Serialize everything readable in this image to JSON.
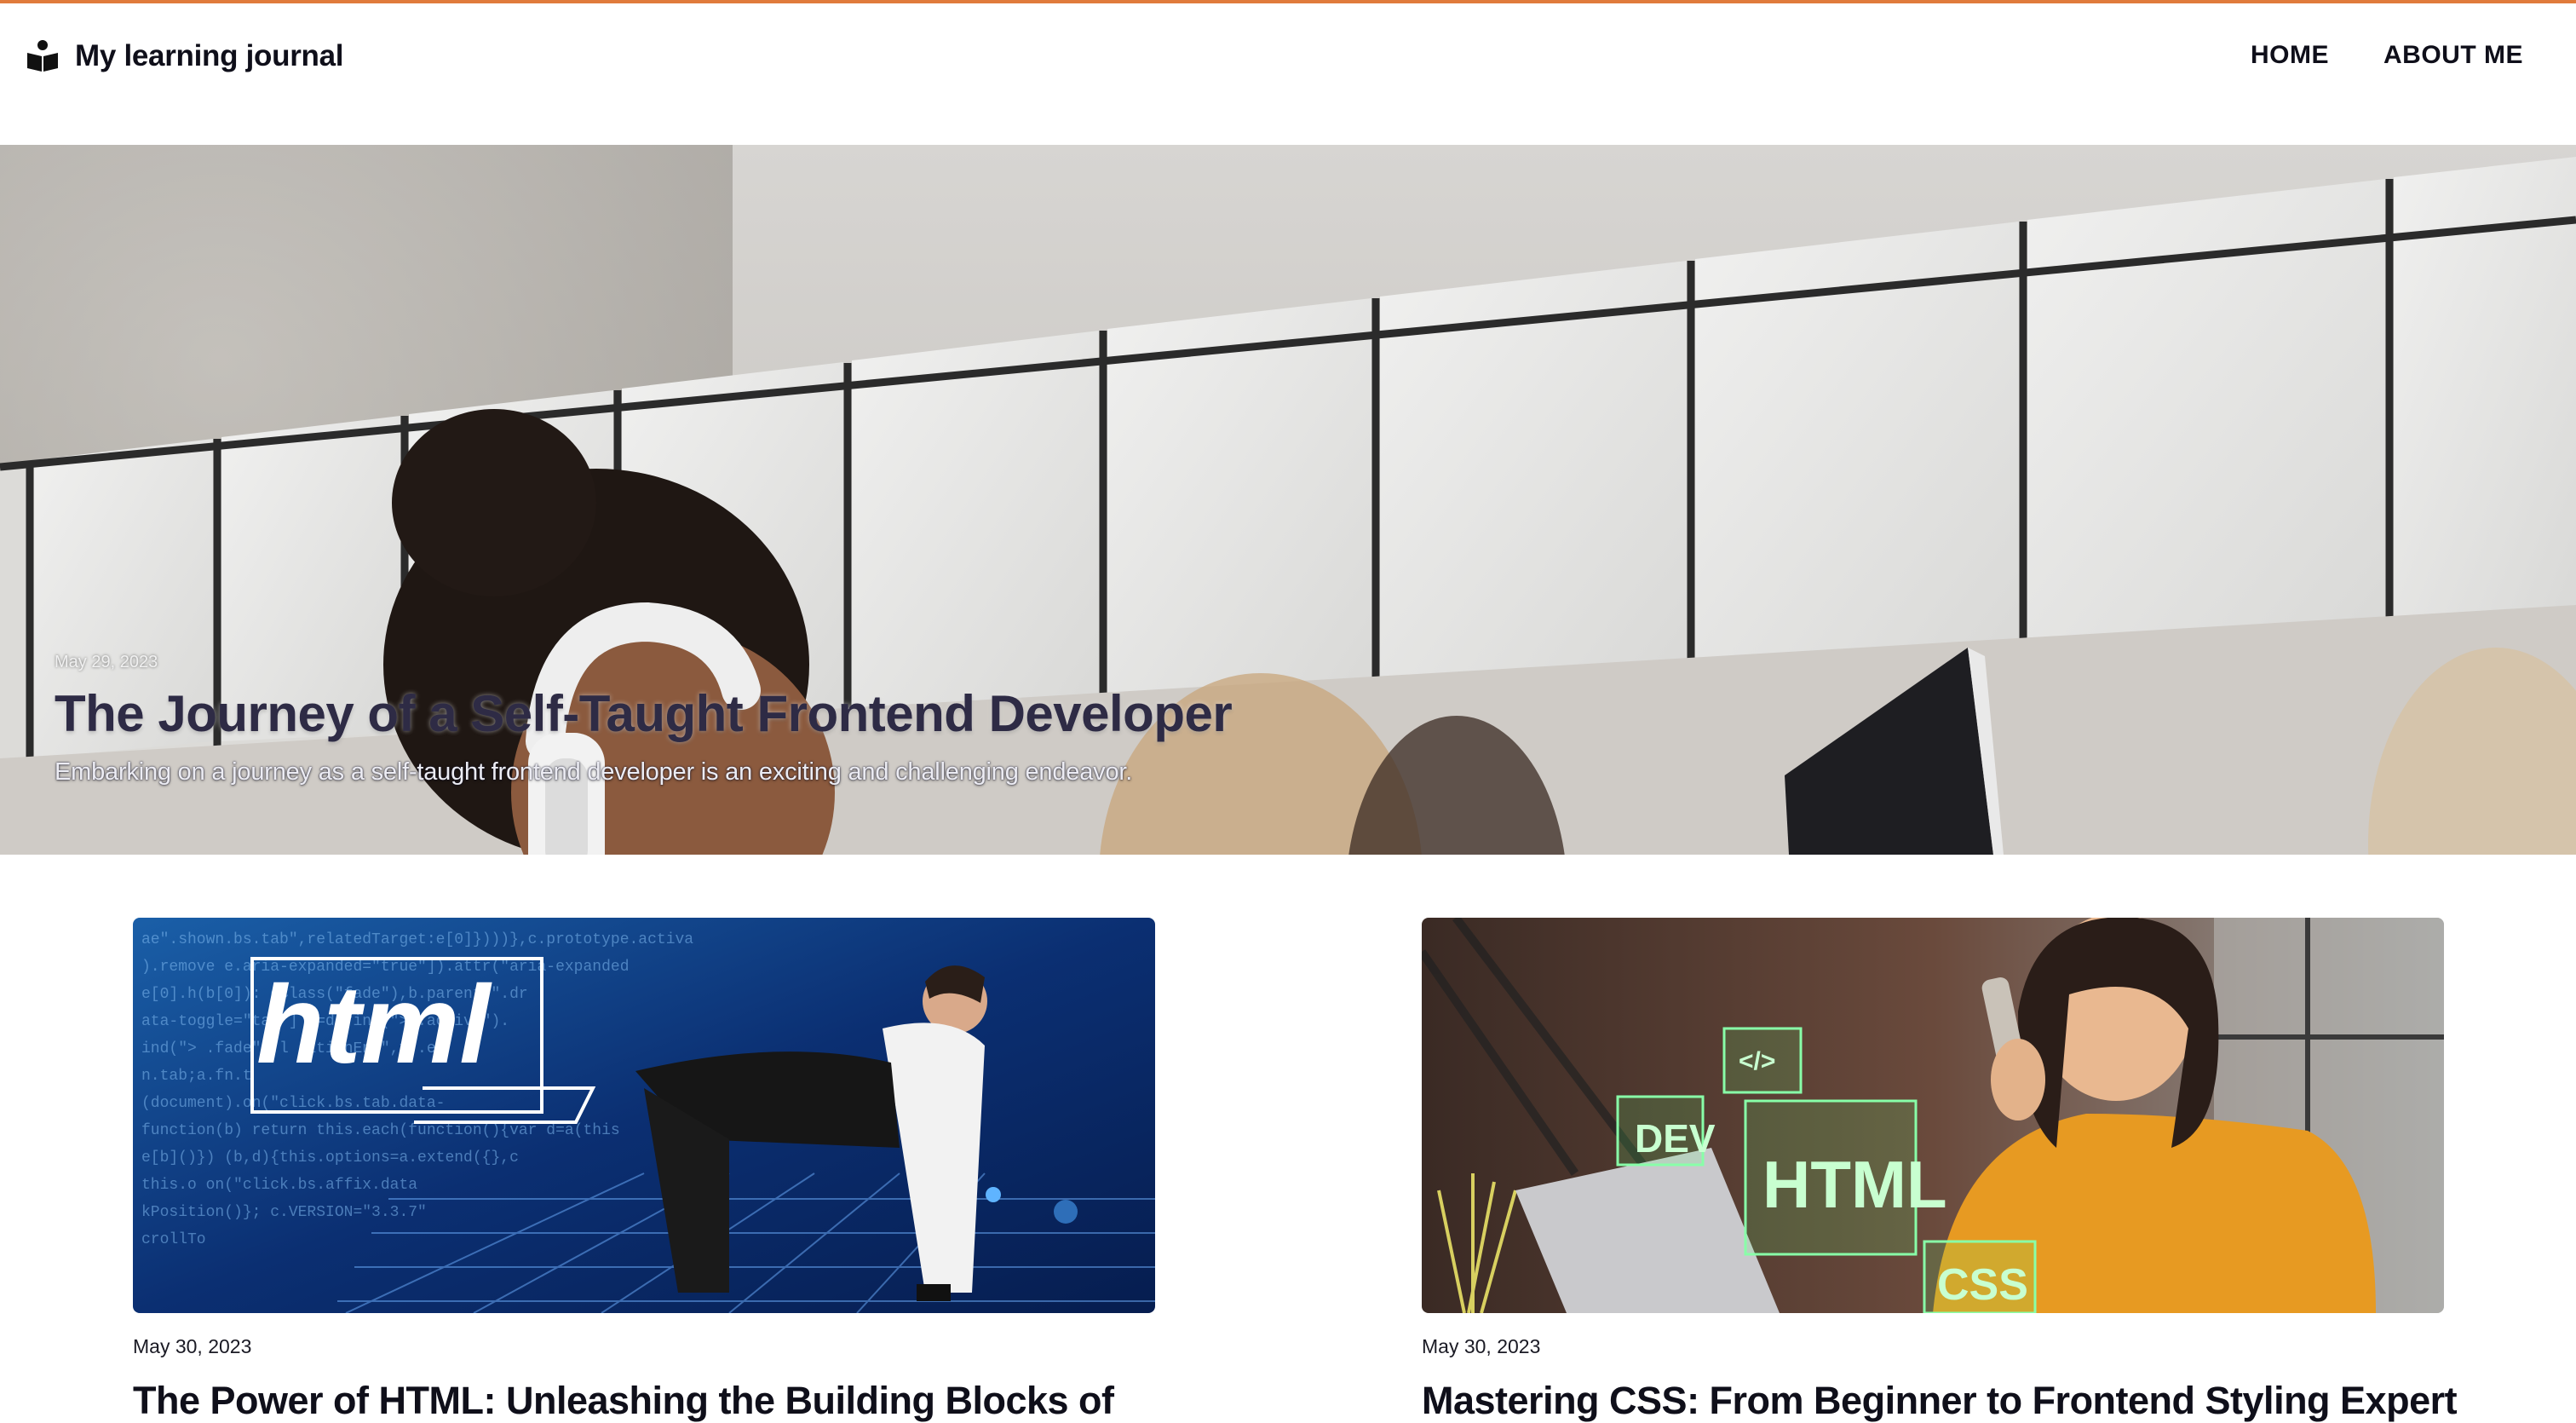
{
  "header": {
    "site_title": "My learning journal",
    "nav": [
      "HOME",
      "ABOUT ME"
    ]
  },
  "hero": {
    "date": "May 29, 2023",
    "title": "The Journey of a Self-Taught Frontend Developer",
    "excerpt": "Embarking on a journey as a self-taught frontend developer is an exciting and challenging endeavor."
  },
  "posts": [
    {
      "date": "May 30, 2023",
      "title": "The Power of HTML: Unleashing the Building Blocks of",
      "image_words": [
        "html"
      ]
    },
    {
      "date": "May 30, 2023",
      "title": "Mastering CSS: From Beginner to Frontend Styling Expert",
      "image_words": [
        "DEV",
        "</>",
        "HTML",
        "CSS"
      ]
    }
  ],
  "colors": {
    "accent_bar": "#e07b3c",
    "text": "#0f0f1a",
    "hero_title": "#2e2b45"
  }
}
